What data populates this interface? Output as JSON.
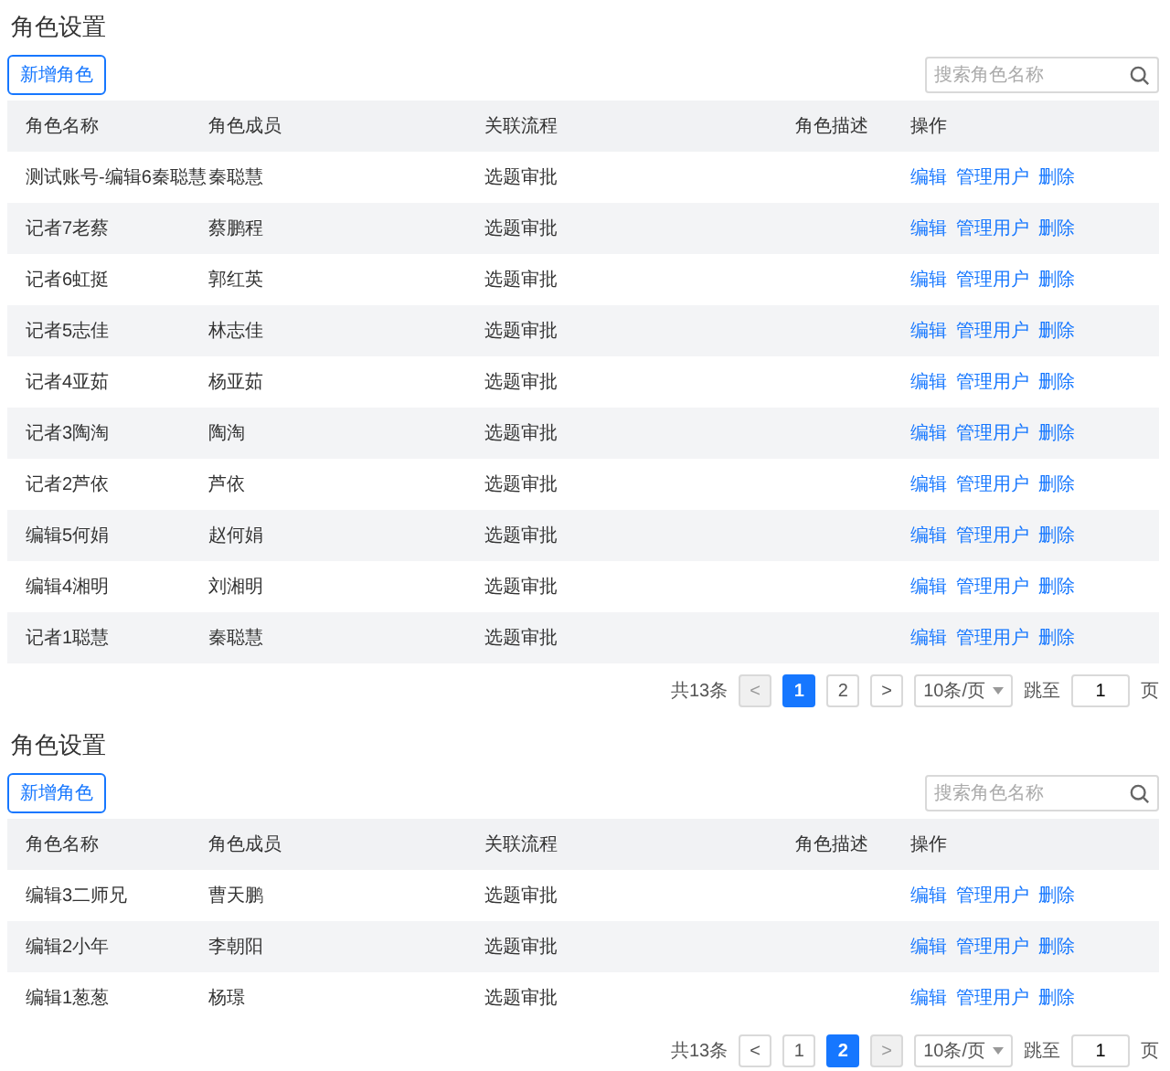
{
  "sections": [
    {
      "title": "角色设置",
      "add_button": "新增角色",
      "search": {
        "placeholder": "搜索角色名称"
      },
      "table": {
        "columns": [
          "角色名称",
          "角色成员",
          "关联流程",
          "角色描述",
          "操作"
        ],
        "rows": [
          {
            "name": "测试账号-编辑6秦聪慧",
            "members": "秦聪慧",
            "flow": "选题审批",
            "actions": [
              "编辑",
              "管理用户",
              "删除"
            ]
          },
          {
            "name": "记者7老蔡",
            "members": "蔡鹏程",
            "flow": "选题审批",
            "actions": [
              "编辑",
              "管理用户",
              "删除"
            ]
          },
          {
            "name": "记者6虹挺",
            "members": "郭红英",
            "flow": "选题审批",
            "actions": [
              "编辑",
              "管理用户",
              "删除"
            ]
          },
          {
            "name": "记者5志佳",
            "members": "林志佳",
            "flow": "选题审批",
            "actions": [
              "编辑",
              "管理用户",
              "删除"
            ]
          },
          {
            "name": "记者4亚茹",
            "members": "杨亚茹",
            "flow": "选题审批",
            "actions": [
              "编辑",
              "管理用户",
              "删除"
            ]
          },
          {
            "name": "记者3陶淘",
            "members": "陶淘",
            "flow": "选题审批",
            "actions": [
              "编辑",
              "管理用户",
              "删除"
            ]
          },
          {
            "name": "记者2芦依",
            "members": "芦依",
            "flow": "选题审批",
            "actions": [
              "编辑",
              "管理用户",
              "删除"
            ]
          },
          {
            "name": "编辑5何娟",
            "members": "赵何娟",
            "flow": "选题审批",
            "actions": [
              "编辑",
              "管理用户",
              "删除"
            ]
          },
          {
            "name": "编辑4湘明",
            "members": "刘湘明",
            "flow": "选题审批",
            "actions": [
              "编辑",
              "管理用户",
              "删除"
            ]
          },
          {
            "name": "记者1聪慧",
            "members": "秦聪慧",
            "flow": "选题审批",
            "actions": [
              "编辑",
              "管理用户",
              "删除"
            ]
          }
        ]
      },
      "pagination": {
        "total": "共13条",
        "prev": {
          "label": "<",
          "disabled": true
        },
        "pages": [
          {
            "label": "1",
            "selected": true
          },
          {
            "label": "2",
            "selected": false
          }
        ],
        "next": {
          "label": ">",
          "disabled": false
        },
        "page_size": "10条/页",
        "jump_label": "跳至",
        "jump_value": "1",
        "page_unit": "页"
      }
    },
    {
      "title": "角色设置",
      "add_button": "新增角色",
      "search": {
        "placeholder": "搜索角色名称"
      },
      "table": {
        "columns": [
          "角色名称",
          "角色成员",
          "关联流程",
          "角色描述",
          "操作"
        ],
        "rows": [
          {
            "name": "编辑3二师兄",
            "members": "曹天鹏",
            "flow": "选题审批",
            "actions": [
              "编辑",
              "管理用户",
              "删除"
            ]
          },
          {
            "name": "编辑2小年",
            "members": "李朝阳",
            "flow": "选题审批",
            "actions": [
              "编辑",
              "管理用户",
              "删除"
            ]
          },
          {
            "name": "编辑1葱葱",
            "members": "杨璟",
            "flow": "选题审批",
            "actions": [
              "编辑",
              "管理用户",
              "删除"
            ]
          }
        ]
      },
      "pagination": {
        "total": "共13条",
        "prev": {
          "label": "<",
          "disabled": false
        },
        "pages": [
          {
            "label": "1",
            "selected": false
          },
          {
            "label": "2",
            "selected": true
          }
        ],
        "next": {
          "label": ">",
          "disabled": true
        },
        "page_size": "10条/页",
        "jump_label": "跳至",
        "jump_value": "1",
        "page_unit": "页"
      }
    }
  ]
}
